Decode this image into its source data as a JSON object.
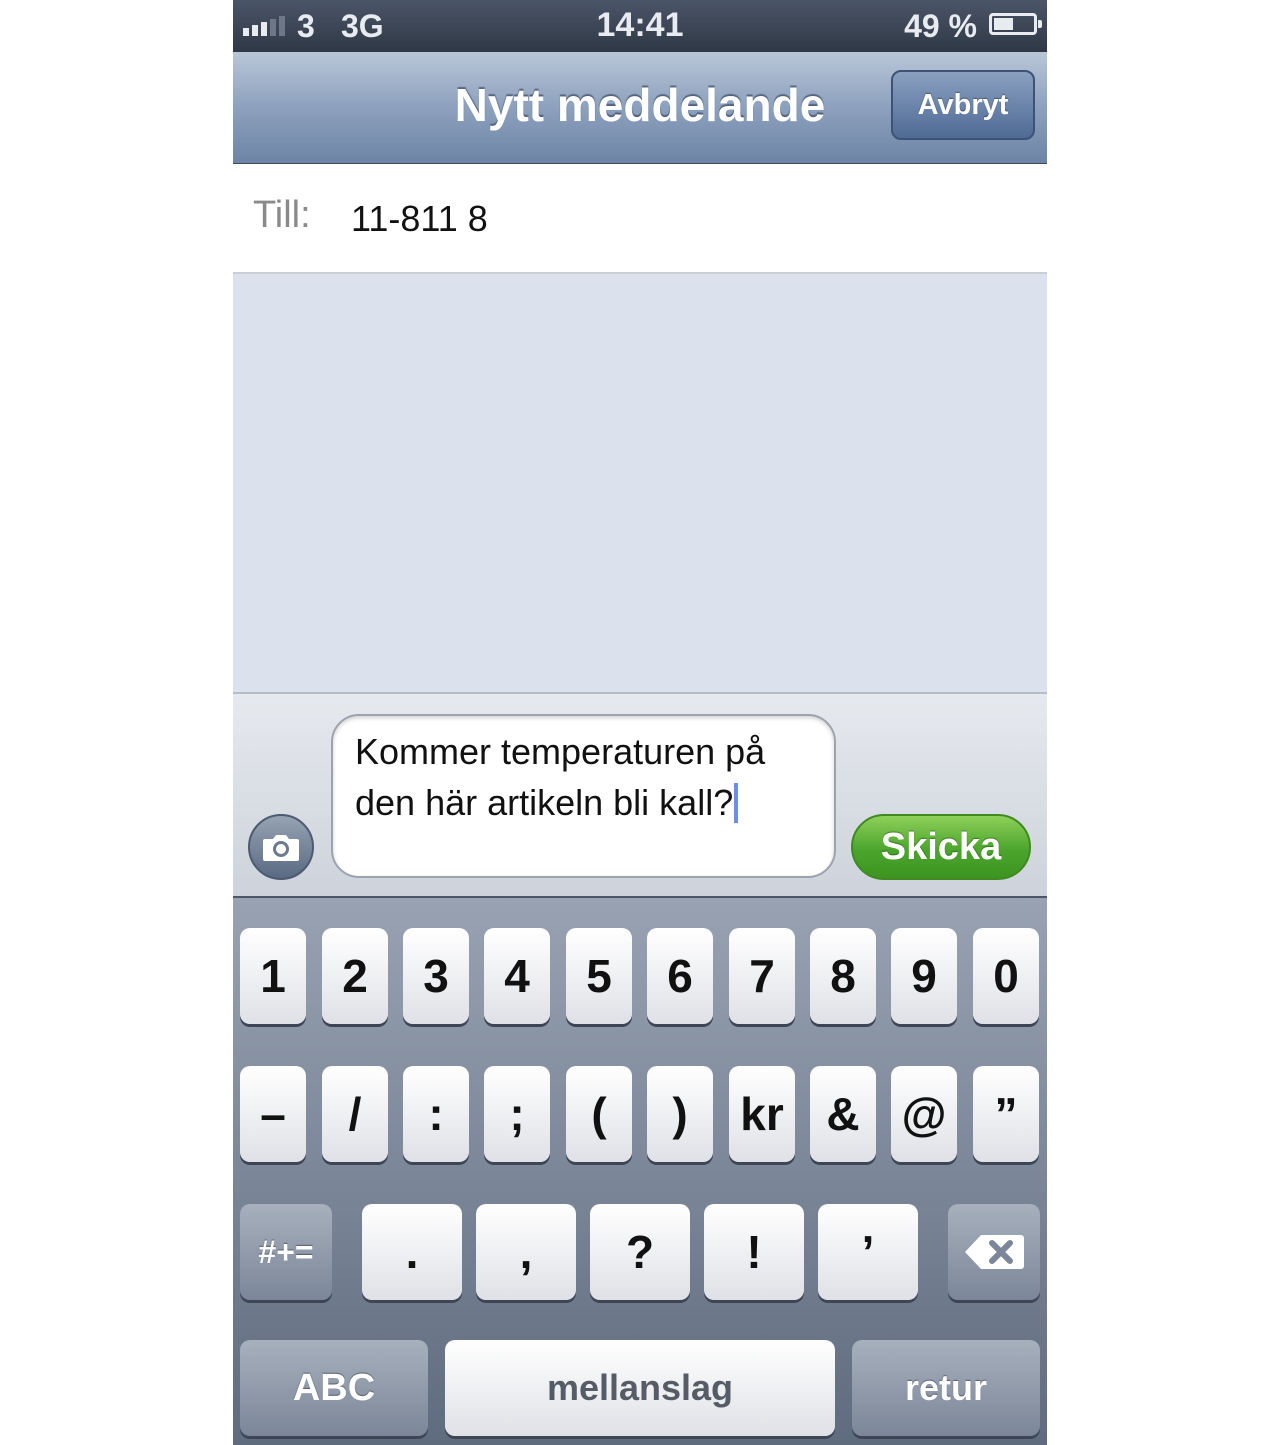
{
  "status_bar": {
    "carrier": "3",
    "network": "3G",
    "time": "14:41",
    "battery_percent_text": "49 %",
    "battery_level": 0.49,
    "signal_bars_filled": 3
  },
  "nav_bar": {
    "title": "Nytt meddelande",
    "cancel_label": "Avbryt"
  },
  "to_field": {
    "label": "Till:",
    "value": "11-811 8"
  },
  "compose": {
    "message_text": "Kommer temperaturen på den här artikeln bli kall?",
    "send_label": "Skicka",
    "camera_icon": "camera-icon"
  },
  "keyboard": {
    "row1": [
      "1",
      "2",
      "3",
      "4",
      "5",
      "6",
      "7",
      "8",
      "9",
      "0"
    ],
    "row2": [
      "–",
      "/",
      ":",
      ";",
      "(",
      ")",
      "kr",
      "&",
      "@",
      "”"
    ],
    "row3": {
      "shift_label": "#+=",
      "keys": [
        ".",
        ",",
        "?",
        "!",
        "’"
      ],
      "delete_icon": "backspace-icon"
    },
    "row4": {
      "mode_label": "ABC",
      "space_label": "mellanslag",
      "return_label": "retur"
    }
  },
  "colors": {
    "nav_bar": "#7f95b5",
    "send_button": "#4ba52c",
    "conversation_bg": "#dbe2ed"
  }
}
